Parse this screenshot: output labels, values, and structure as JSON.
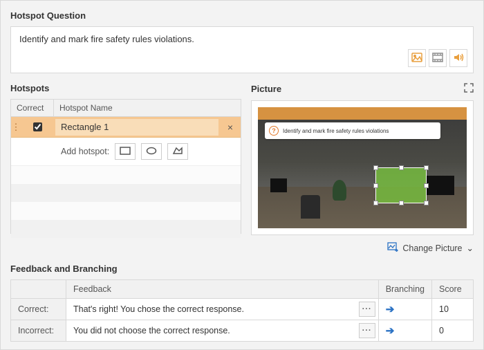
{
  "titles": {
    "main": "Hotspot Question",
    "hotspots": "Hotspots",
    "picture": "Picture",
    "feedback": "Feedback and Branching"
  },
  "question": {
    "text": "Identify and mark fire safety rules violations."
  },
  "hotspot_table": {
    "headers": {
      "correct": "Correct",
      "name": "Hotspot Name"
    },
    "rows": [
      {
        "correct": true,
        "name": "Rectangle 1"
      }
    ],
    "add_label": "Add hotspot:"
  },
  "icons": {
    "image": "image-icon",
    "video": "video-icon",
    "audio": "audio-icon",
    "expand": "expand-icon",
    "close": "×",
    "drag": "⋮",
    "change_pic": "Change Picture",
    "chevron": "⌄",
    "arrow": "➔"
  },
  "picture_preview": {
    "question_overlay": "Identify and mark fire safety rules violations"
  },
  "feedback_table": {
    "headers": {
      "blank": "",
      "feedback": "Feedback",
      "branching": "Branching",
      "score": "Score"
    },
    "rows": {
      "correct": {
        "label": "Correct:",
        "text": "That's right! You chose the correct response.",
        "score": "10"
      },
      "incorrect": {
        "label": "Incorrect:",
        "text": "You did not choose the correct response.",
        "score": "0"
      }
    }
  }
}
